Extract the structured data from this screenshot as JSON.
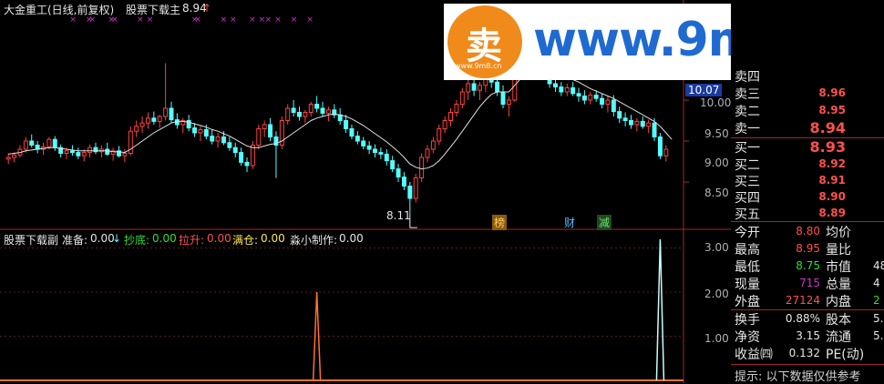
{
  "header": {
    "title": "大金重工(日线,前复权)",
    "indicator_name": "股票下载主",
    "indicator_value": "8.94"
  },
  "indicator_line": {
    "name": "股票下载副",
    "zhunbei_label": "准备:",
    "zhunbei_value": "0.00",
    "chaodi_label": "抄底:",
    "chaodi_value": "0.00",
    "lasheng_label": "拉升:",
    "lasheng_value": "0.00",
    "mancang_label": "满仓:",
    "mancang_value": "0.00",
    "author_label": "淼小制作:",
    "author_value": "0.00"
  },
  "watermark": {
    "text": "www.9m8.cn",
    "logo_char": "卖",
    "logo_sub": "www.9m8.cn"
  },
  "price_axis": {
    "current_price_box": "10.07",
    "ticks": [
      "10.00",
      "9.50",
      "9.00",
      "8.50"
    ]
  },
  "indicator_axis": {
    "ticks": [
      "3.00",
      "2.00",
      "1.00"
    ]
  },
  "annotations": {
    "low_label": "8.11",
    "badge_bang": "榜",
    "badge_cai": "财",
    "badge_jian": "减"
  },
  "order_book": {
    "asks": [
      {
        "label": "卖四",
        "value": ""
      },
      {
        "label": "卖三",
        "value": "8.96"
      },
      {
        "label": "卖二",
        "value": "8.95"
      },
      {
        "label": "卖一",
        "value": "8.94"
      }
    ],
    "bids": [
      {
        "label": "买一",
        "value": "8.93"
      },
      {
        "label": "买二",
        "value": "8.92"
      },
      {
        "label": "买三",
        "value": "8.91"
      },
      {
        "label": "买四",
        "value": "8.90"
      },
      {
        "label": "买五",
        "value": "8.89"
      }
    ]
  },
  "stats": {
    "open_label": "今开",
    "open_value": "8.80",
    "avg_label": "均价",
    "high_label": "最高",
    "high_value": "8.95",
    "vol_ratio_label": "量比",
    "low_label": "最低",
    "low_value": "8.75",
    "mkt_cap_label": "市值",
    "mkt_cap_value": "48",
    "cur_vol_label": "现量",
    "cur_vol_value": "715",
    "total_vol_label": "总量",
    "total_vol_value": "4",
    "outer_label": "外盘",
    "outer_value": "27124",
    "inner_label": "内盘",
    "inner_value": "2",
    "turnover_label": "换手",
    "turnover_value": "0.88%",
    "shares_label": "股本",
    "shares_value": "5.",
    "nav_label": "净资",
    "nav_value": "3.15",
    "float_label": "流通",
    "float_value": "5.",
    "eps_label": "收益㈣",
    "eps_value": "0.132",
    "pe_label": "PE(动)",
    "tip_text": "提示: 以下数据仅供参考"
  },
  "colors": {
    "up": "#ff4040",
    "down": "#54ffff",
    "ma": "#e0e0e0",
    "red_text": "#ff5050",
    "green_text": "#33dd33",
    "purple": "#cc33cc",
    "orange": "#ff7030",
    "axis": "#9a2a2a"
  },
  "chart_data": {
    "type": "candlestick",
    "price_ylim": [
      8.0,
      10.5
    ],
    "indicator_ylim": [
      0.0,
      3.3
    ],
    "candles": [
      [
        8.78,
        8.85,
        8.72,
        8.8
      ],
      [
        8.8,
        8.86,
        8.74,
        8.83
      ],
      [
        8.83,
        8.95,
        8.8,
        8.9
      ],
      [
        8.9,
        9.05,
        8.86,
        9.0
      ],
      [
        9.0,
        9.08,
        8.92,
        8.95
      ],
      [
        8.95,
        9.0,
        8.85,
        8.9
      ],
      [
        8.9,
        8.98,
        8.83,
        8.93
      ],
      [
        8.93,
        9.05,
        8.9,
        9.02
      ],
      [
        9.02,
        9.06,
        8.88,
        8.92
      ],
      [
        8.92,
        8.96,
        8.8,
        8.85
      ],
      [
        8.85,
        8.92,
        8.78,
        8.88
      ],
      [
        8.88,
        8.95,
        8.82,
        8.86
      ],
      [
        8.86,
        8.92,
        8.78,
        8.82
      ],
      [
        8.82,
        8.9,
        8.75,
        8.86
      ],
      [
        8.86,
        8.96,
        8.8,
        8.92
      ],
      [
        8.92,
        8.98,
        8.84,
        8.87
      ],
      [
        8.87,
        8.95,
        8.8,
        8.9
      ],
      [
        8.9,
        8.98,
        8.82,
        8.84
      ],
      [
        8.84,
        8.92,
        8.76,
        8.88
      ],
      [
        8.88,
        8.94,
        8.8,
        8.82
      ],
      [
        8.82,
        8.9,
        8.74,
        8.85
      ],
      [
        8.85,
        9.18,
        8.82,
        9.12
      ],
      [
        9.12,
        9.25,
        9.05,
        9.18
      ],
      [
        9.18,
        9.3,
        9.1,
        9.22
      ],
      [
        9.22,
        9.35,
        9.15,
        9.28
      ],
      [
        9.28,
        9.36,
        9.2,
        9.24
      ],
      [
        9.24,
        9.32,
        9.16,
        9.3
      ],
      [
        9.3,
        9.95,
        9.25,
        9.4
      ],
      [
        9.4,
        9.48,
        9.22,
        9.26
      ],
      [
        9.26,
        9.34,
        9.15,
        9.2
      ],
      [
        9.2,
        9.28,
        9.1,
        9.25
      ],
      [
        9.25,
        9.32,
        9.12,
        9.16
      ],
      [
        9.16,
        9.22,
        9.05,
        9.1
      ],
      [
        9.1,
        9.18,
        9.0,
        9.14
      ],
      [
        9.14,
        9.2,
        9.02,
        9.06
      ],
      [
        9.06,
        9.14,
        8.96,
        9.0
      ],
      [
        9.0,
        9.1,
        8.92,
        9.05
      ],
      [
        9.05,
        9.12,
        8.95,
        8.98
      ],
      [
        8.98,
        9.05,
        8.88,
        8.92
      ],
      [
        8.92,
        8.98,
        8.8,
        8.86
      ],
      [
        8.86,
        8.92,
        8.7,
        8.74
      ],
      [
        8.74,
        8.8,
        8.62,
        8.7
      ],
      [
        8.7,
        9.0,
        8.66,
        8.95
      ],
      [
        8.95,
        9.2,
        8.9,
        9.15
      ],
      [
        9.15,
        9.25,
        9.05,
        9.2
      ],
      [
        9.2,
        9.28,
        9.0,
        9.05
      ],
      [
        9.05,
        9.12,
        8.55,
        8.95
      ],
      [
        8.95,
        9.3,
        8.9,
        9.25
      ],
      [
        9.25,
        9.45,
        9.2,
        9.4
      ],
      [
        9.4,
        9.5,
        9.3,
        9.35
      ],
      [
        9.35,
        9.42,
        9.25,
        9.3
      ],
      [
        9.3,
        9.38,
        9.22,
        9.35
      ],
      [
        9.35,
        9.48,
        9.3,
        9.45
      ],
      [
        9.45,
        9.55,
        9.35,
        9.4
      ],
      [
        9.4,
        9.48,
        9.3,
        9.34
      ],
      [
        9.34,
        9.42,
        9.24,
        9.38
      ],
      [
        9.38,
        9.45,
        9.28,
        9.32
      ],
      [
        9.32,
        9.4,
        9.2,
        9.25
      ],
      [
        9.25,
        9.32,
        9.1,
        9.15
      ],
      [
        9.15,
        9.2,
        9.02,
        9.06
      ],
      [
        9.06,
        9.12,
        8.96,
        9.0
      ],
      [
        9.0,
        9.05,
        8.9,
        8.94
      ],
      [
        8.94,
        9.0,
        8.84,
        8.9
      ],
      [
        8.9,
        8.96,
        8.8,
        8.86
      ],
      [
        8.86,
        8.92,
        8.78,
        8.84
      ],
      [
        8.84,
        8.9,
        8.7,
        8.76
      ],
      [
        8.76,
        8.82,
        8.62,
        8.66
      ],
      [
        8.66,
        8.72,
        8.5,
        8.56
      ],
      [
        8.56,
        8.62,
        8.4,
        8.45
      ],
      [
        8.45,
        8.5,
        8.11,
        8.3
      ],
      [
        8.3,
        8.6,
        8.25,
        8.55
      ],
      [
        8.55,
        8.85,
        8.5,
        8.8
      ],
      [
        8.8,
        8.95,
        8.74,
        8.9
      ],
      [
        8.9,
        9.05,
        8.85,
        9.0
      ],
      [
        9.0,
        9.2,
        8.95,
        9.15
      ],
      [
        9.15,
        9.3,
        9.1,
        9.25
      ],
      [
        9.25,
        9.4,
        9.18,
        9.35
      ],
      [
        9.35,
        9.5,
        9.3,
        9.45
      ],
      [
        9.45,
        9.65,
        9.4,
        9.6
      ],
      [
        9.6,
        9.75,
        9.5,
        9.7
      ],
      [
        9.7,
        9.8,
        9.55,
        9.62
      ],
      [
        9.62,
        9.72,
        9.5,
        9.68
      ],
      [
        9.68,
        9.82,
        9.6,
        9.78
      ],
      [
        9.78,
        9.88,
        9.65,
        9.72
      ],
      [
        9.72,
        9.8,
        9.55,
        9.6
      ],
      [
        9.6,
        9.68,
        9.4,
        9.45
      ],
      [
        9.45,
        9.55,
        9.3,
        9.5
      ],
      [
        9.5,
        10.6,
        9.48,
        10.45
      ],
      [
        10.45,
        10.55,
        10.1,
        10.2
      ],
      [
        10.2,
        10.3,
        9.95,
        10.05
      ],
      [
        10.05,
        10.12,
        9.88,
        9.95
      ],
      [
        9.95,
        10.05,
        9.85,
        9.92
      ],
      [
        9.92,
        10.0,
        9.8,
        9.86
      ],
      [
        9.86,
        9.9,
        9.65,
        9.7
      ],
      [
        9.7,
        9.78,
        9.6,
        9.66
      ],
      [
        9.66,
        9.72,
        9.55,
        9.6
      ],
      [
        9.6,
        9.7,
        9.55,
        9.65
      ],
      [
        9.65,
        9.72,
        9.55,
        9.58
      ],
      [
        9.58,
        9.65,
        9.48,
        9.55
      ],
      [
        9.55,
        9.62,
        9.45,
        9.5
      ],
      [
        9.5,
        9.6,
        9.45,
        9.56
      ],
      [
        9.56,
        9.62,
        9.48,
        9.52
      ],
      [
        9.52,
        9.58,
        9.4,
        9.45
      ],
      [
        9.45,
        9.55,
        9.35,
        9.5
      ],
      [
        9.5,
        9.56,
        9.3,
        9.36
      ],
      [
        9.36,
        9.42,
        9.22,
        9.28
      ],
      [
        9.28,
        9.35,
        9.18,
        9.25
      ],
      [
        9.25,
        9.32,
        9.15,
        9.2
      ],
      [
        9.2,
        9.28,
        9.12,
        9.24
      ],
      [
        9.24,
        9.3,
        9.15,
        9.18
      ],
      [
        9.18,
        9.26,
        9.1,
        9.22
      ],
      [
        9.22,
        9.28,
        9.0,
        9.05
      ],
      [
        9.05,
        9.1,
        8.78,
        8.82
      ],
      [
        8.82,
        8.95,
        8.75,
        8.9
      ]
    ],
    "ma": [
      8.84,
      8.85,
      8.86,
      8.88,
      8.89,
      8.9,
      8.91,
      8.92,
      8.92,
      8.91,
      8.9,
      8.89,
      8.88,
      8.88,
      8.88,
      8.88,
      8.88,
      8.88,
      8.87,
      8.87,
      8.86,
      8.9,
      8.95,
      9.0,
      9.05,
      9.1,
      9.14,
      9.18,
      9.22,
      9.24,
      9.24,
      9.23,
      9.21,
      9.19,
      9.17,
      9.14,
      9.12,
      9.09,
      9.06,
      9.02,
      8.98,
      8.94,
      8.92,
      8.92,
      8.94,
      8.96,
      8.97,
      9.0,
      9.05,
      9.1,
      9.15,
      9.2,
      9.25,
      9.28,
      9.3,
      9.32,
      9.33,
      9.32,
      9.3,
      9.27,
      9.23,
      9.19,
      9.14,
      9.09,
      9.04,
      8.99,
      8.93,
      8.87,
      8.8,
      8.72,
      8.68,
      8.66,
      8.67,
      8.7,
      8.76,
      8.84,
      8.93,
      9.02,
      9.12,
      9.22,
      9.32,
      9.42,
      9.5,
      9.57,
      9.6,
      9.6,
      9.6,
      9.68,
      9.76,
      9.82,
      9.86,
      9.88,
      9.89,
      9.88,
      9.86,
      9.83,
      9.79,
      9.75,
      9.72,
      9.68,
      9.64,
      9.61,
      9.58,
      9.55,
      9.52,
      9.48,
      9.44,
      9.4,
      9.36,
      9.32,
      9.28,
      9.24,
      9.18,
      9.1,
      9.02
    ],
    "indicator_spikes": [
      {
        "index": 53,
        "value": 2.0,
        "color": "#ff7030"
      },
      {
        "index": 112,
        "value": 3.2,
        "color": "#c8ffff"
      }
    ],
    "signal_marks": [
      10,
      15,
      16,
      22,
      23,
      31,
      34,
      48,
      49,
      57,
      60,
      66,
      69,
      71,
      74,
      79,
      84
    ]
  }
}
